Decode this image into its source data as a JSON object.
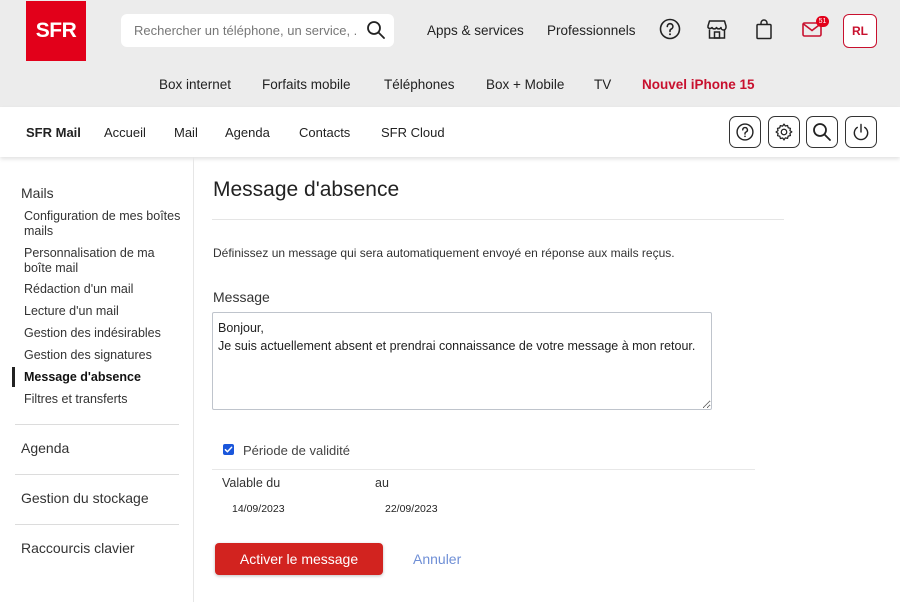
{
  "header": {
    "logo": "SFR",
    "search_placeholder": "Rechercher un téléphone, un service, ...",
    "links": [
      "Apps & services",
      "Professionnels"
    ],
    "mail_count": "51",
    "avatar": "RL",
    "nav": [
      "Box internet",
      "Forfaits mobile",
      "Téléphones",
      "Box + Mobile",
      "TV"
    ],
    "promo": "Nouvel iPhone 15"
  },
  "appnav": {
    "brand": "SFR Mail",
    "items": [
      "Accueil",
      "Mail",
      "Agenda",
      "Contacts",
      "SFR Cloud"
    ]
  },
  "sidebar": {
    "mails_heading": "Mails",
    "items": [
      "Configuration de mes boîtes mails",
      "Personnalisation de ma boîte mail",
      "Rédaction d'un mail",
      "Lecture d'un mail",
      "Gestion des indésirables",
      "Gestion des signatures",
      "Message d'absence",
      "Filtres et transferts"
    ],
    "active_index": 6,
    "sections": [
      "Agenda",
      "Gestion du stockage",
      "Raccourcis clavier"
    ]
  },
  "main": {
    "title": "Message d'absence",
    "intro": "Définissez un message qui sera automatiquement envoyé en réponse aux mails reçus.",
    "message_label": "Message",
    "message_value": "Bonjour,\nJe suis actuellement absent et prendrai connaissance de votre message à mon retour.",
    "validity_label": "Période de validité",
    "validity_checked": true,
    "from_label": "Valable du",
    "to_label": "au",
    "from_value": "14/09/2023",
    "to_value": "22/09/2023",
    "activate_label": "Activer le message",
    "cancel_label": "Annuler"
  },
  "colors": {
    "brand": "#e2001a",
    "primary_button": "#d2231f",
    "link": "#6f8fd6",
    "checkbox": "#1a56db"
  }
}
